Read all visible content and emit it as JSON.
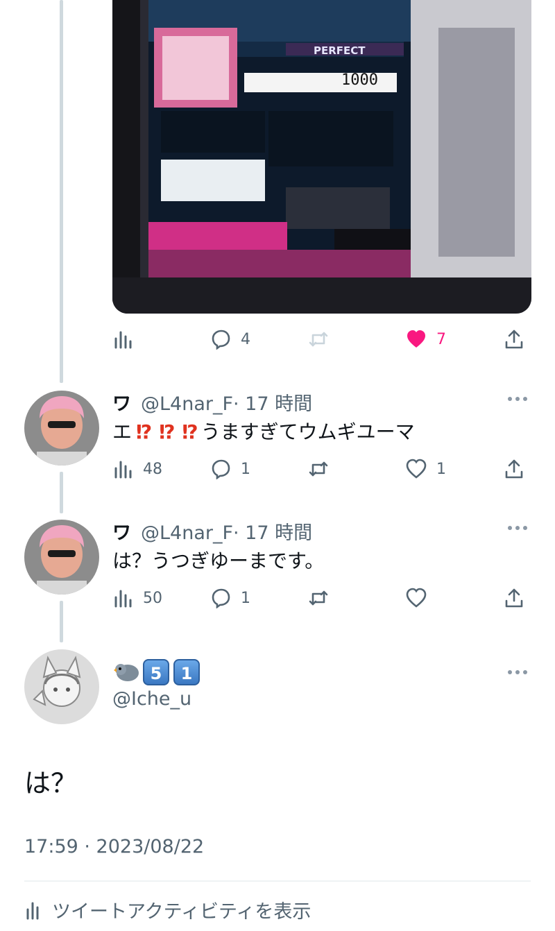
{
  "top_tweet": {
    "actions": {
      "replies": "4",
      "likes": "7"
    },
    "like_color": "#f91880"
  },
  "replies": [
    {
      "display_name": "ワ",
      "handle": "@L4nar_F",
      "time": "· 17 時間",
      "text_prefix": "エ",
      "text_bangs": [
        "⁉",
        "⁉",
        "⁉"
      ],
      "text_suffix": "うますぎてウムギユーマ",
      "views": "48",
      "replies": "1",
      "likes": "1"
    },
    {
      "display_name": "ワ",
      "handle": "@L4nar_F",
      "time": "· 17 時間",
      "text": "は？うつぎゆーまです。",
      "views": "50",
      "replies": "1",
      "likes": ""
    }
  ],
  "main_tweet": {
    "name_keys": [
      "5",
      "1"
    ],
    "handle": "@Iche_u",
    "text": "は？",
    "timestamp": "17:59 · 2023/08/22",
    "activity_link": "ツイートアクティビティを表示"
  },
  "icons": [
    "views-icon",
    "reply-icon",
    "retweet-icon",
    "like-icon",
    "share-icon",
    "more-icon",
    "bird-emoji-icon"
  ],
  "colors": {
    "text_secondary": "#536471",
    "thread_line": "#cfd9de",
    "divider": "#eff3f4"
  }
}
